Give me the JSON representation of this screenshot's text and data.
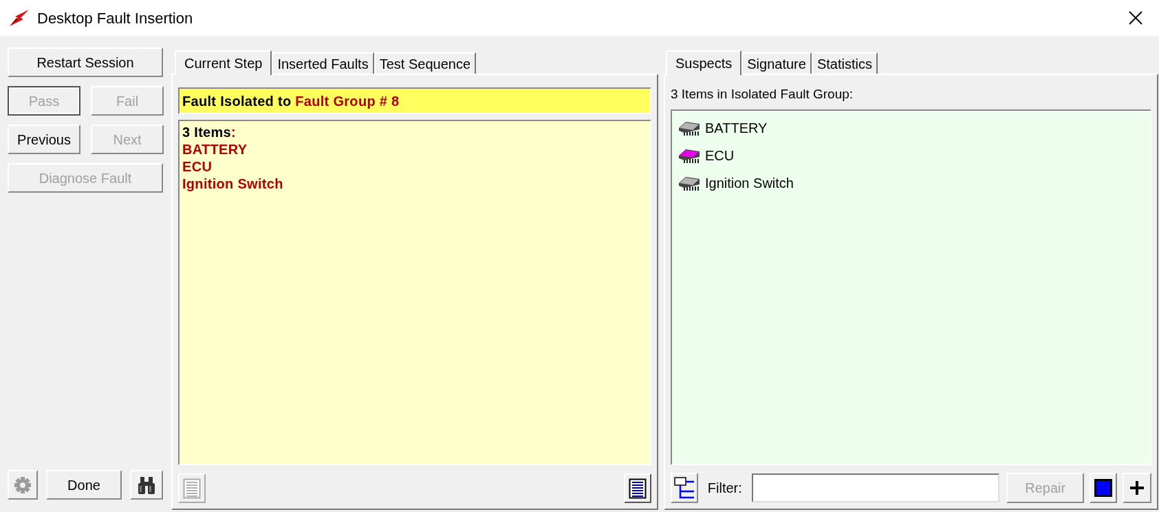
{
  "window": {
    "title": "Desktop Fault Insertion"
  },
  "session_controls": [
    [
      {
        "label": "Restart Session",
        "disabled": false,
        "default": false
      }
    ],
    [
      {
        "label": "Pass",
        "disabled": true,
        "default": true
      },
      {
        "label": "Fail",
        "disabled": true,
        "default": false
      }
    ],
    [
      {
        "label": "Previous",
        "disabled": false,
        "default": false
      },
      {
        "label": "Next",
        "disabled": true,
        "default": false
      }
    ],
    [
      {
        "label": "Diagnose Fault",
        "disabled": true,
        "default": false
      }
    ]
  ],
  "done_button": {
    "label": "Done"
  },
  "step_tabs": [
    {
      "label": "Current Step",
      "selected": true
    },
    {
      "label": "Inserted Faults",
      "selected": false
    },
    {
      "label": "Test Sequence",
      "selected": false
    }
  ],
  "fault_banner": {
    "prefix": "Fault Isolated to ",
    "group": "Fault Group # 8"
  },
  "items_panel": {
    "count": "3 Items",
    "colon": ":",
    "items": [
      "BATTERY",
      "ECU",
      "Ignition Switch"
    ]
  },
  "view_toggles": [
    {
      "kind": "plain",
      "selected": false
    },
    {
      "kind": "detailed",
      "selected": true
    }
  ],
  "suspect_tabs": [
    {
      "label": "Suspects",
      "selected": true
    },
    {
      "label": "Signature",
      "selected": false
    },
    {
      "label": "Statistics",
      "selected": false
    }
  ],
  "suspects_heading": "3 Items in Isolated Fault Group:",
  "suspects": [
    {
      "name": "BATTERY",
      "color": "#b4b4b4"
    },
    {
      "name": "ECU",
      "color": "#e800e8"
    },
    {
      "name": "Ignition Switch",
      "color": "#b4b4b4"
    }
  ],
  "filter": {
    "label": "Filter:"
  },
  "repair_button": {
    "label": "Repair",
    "disabled": true
  }
}
